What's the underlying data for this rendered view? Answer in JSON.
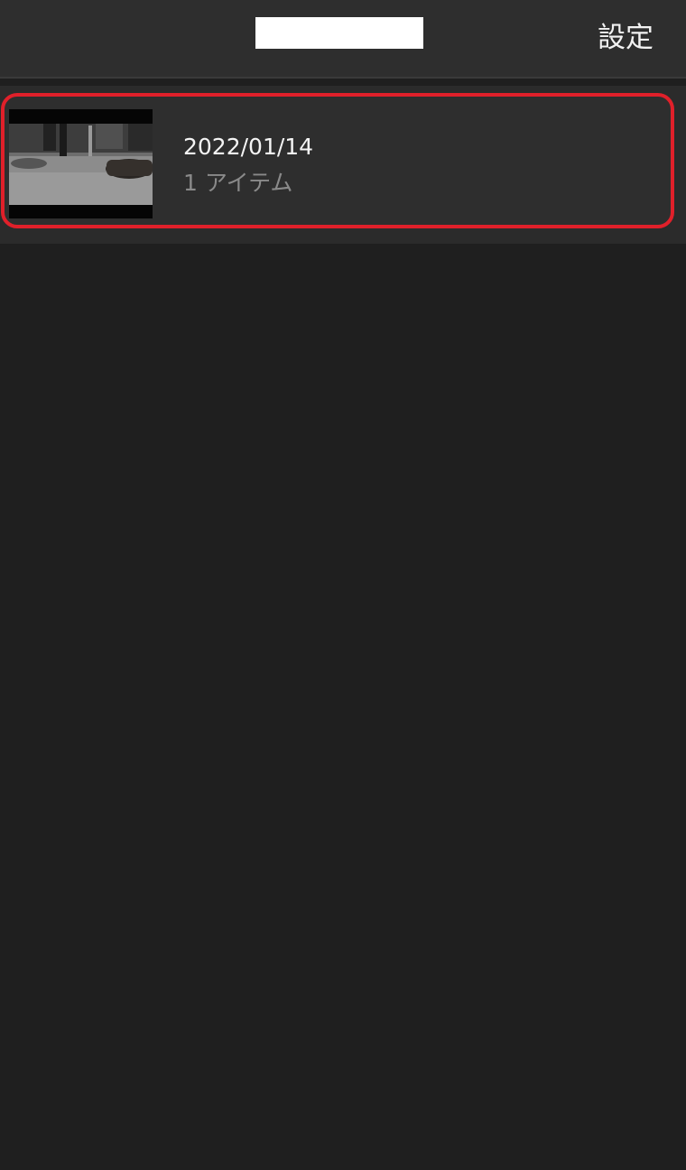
{
  "header": {
    "settings_label": "設定"
  },
  "albums": [
    {
      "date": "2022/01/14",
      "count_label": "1 アイテム"
    }
  ],
  "colors": {
    "background": "#1f1f1f",
    "header": "#2e2e2e",
    "highlight": "#e0202a"
  },
  "icons": {
    "thumbnail": "video-thumbnail-image"
  }
}
